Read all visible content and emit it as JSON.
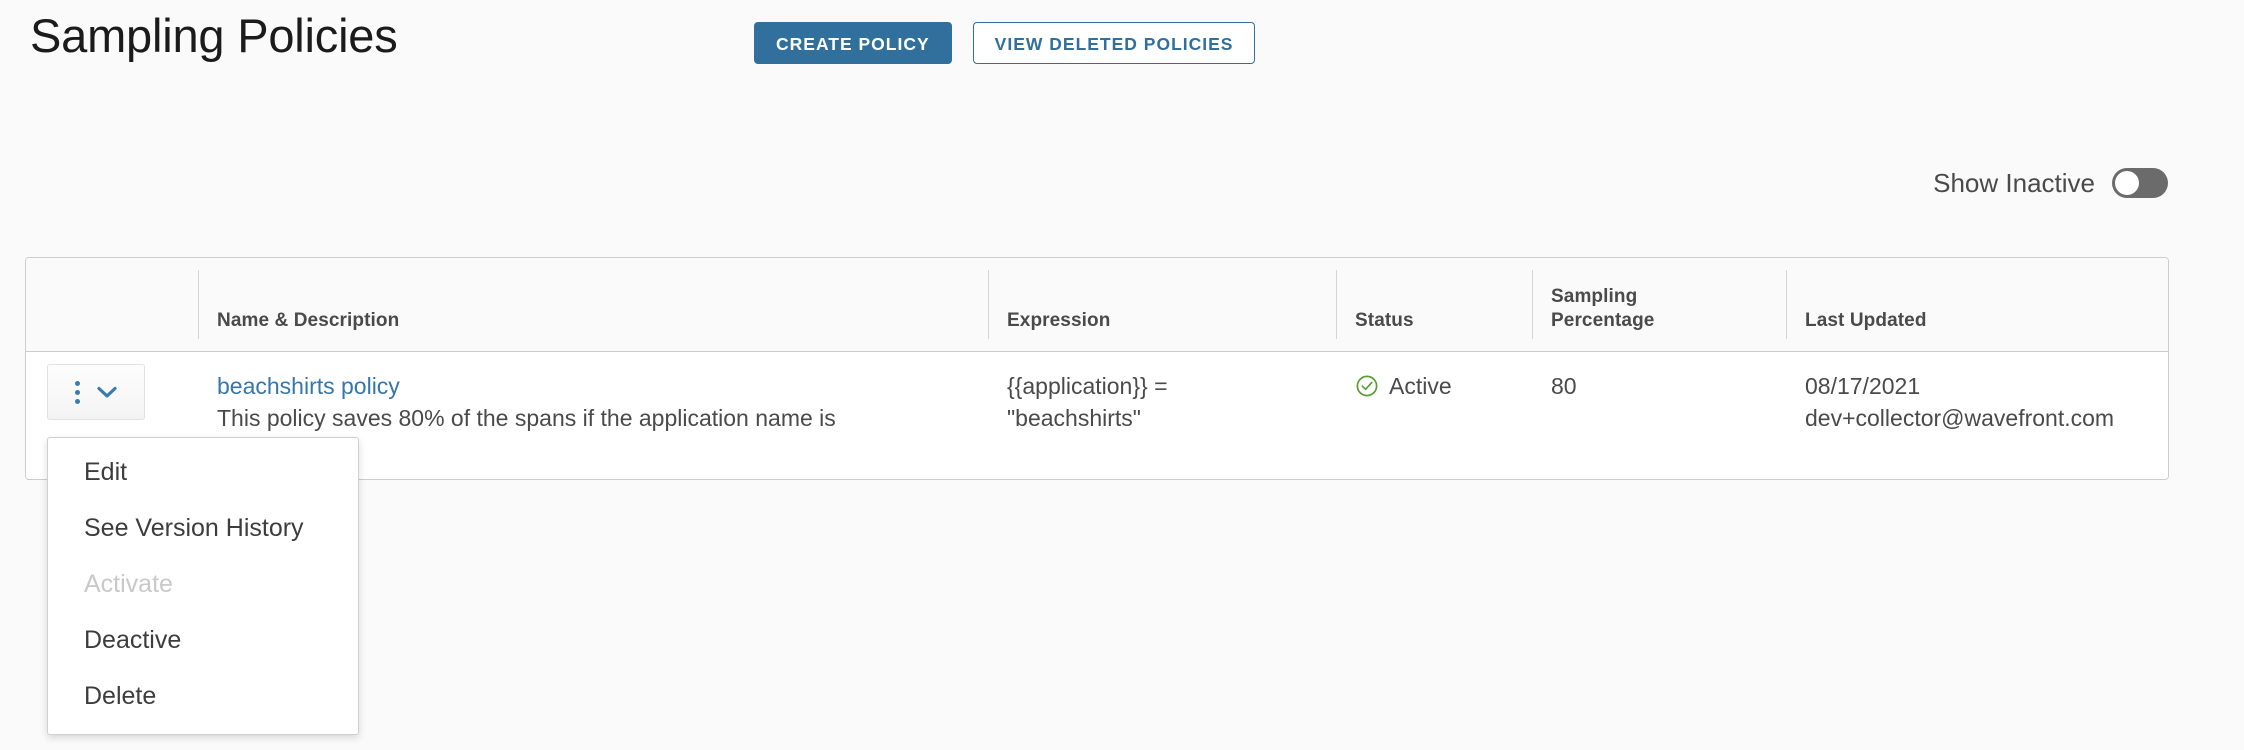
{
  "header": {
    "title": "Sampling Policies",
    "create_button": "CREATE POLICY",
    "view_deleted_button": "VIEW DELETED POLICIES"
  },
  "filters": {
    "show_inactive_label": "Show Inactive",
    "show_inactive_on": false
  },
  "table": {
    "columns": {
      "actions": "",
      "name": "Name & Description",
      "expression": "Expression",
      "status": "Status",
      "sampling": "Sampling\nPercentage",
      "updated": "Last Updated"
    },
    "rows": [
      {
        "name": "beachshirts policy",
        "description": "This policy saves 80% of the spans if the application name is",
        "expression": "{{application}} =\n\"beachshirts\"",
        "status": "Active",
        "status_icon": "check-circle-icon",
        "sampling_percentage": "80",
        "updated_date": "08/17/2021",
        "updated_by": "dev+collector@wavefront.com"
      }
    ]
  },
  "row_menu": {
    "items": [
      {
        "label": "Edit",
        "disabled": false
      },
      {
        "label": "See Version History",
        "disabled": false
      },
      {
        "label": "Activate",
        "disabled": true
      },
      {
        "label": "Deactive",
        "disabled": false
      },
      {
        "label": "Delete",
        "disabled": false
      }
    ]
  },
  "colors": {
    "accent_blue": "#31709c",
    "link_blue": "#3577ab",
    "status_green": "#5d9b35",
    "page_background": "#fafafa",
    "toggle_off_track": "#6b6b6b"
  }
}
